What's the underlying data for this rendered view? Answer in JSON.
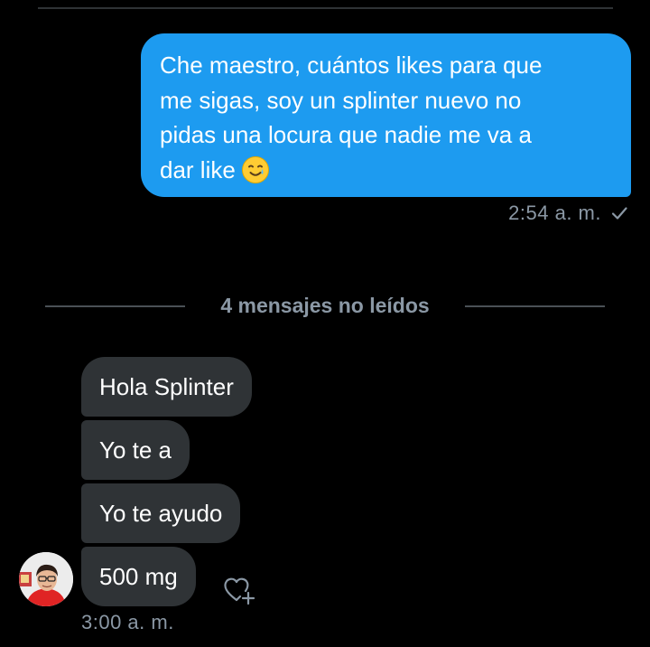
{
  "conversation": {
    "sent": {
      "lines": [
        "Che maestro, cuántos likes para que",
        "me sigas, soy un splinter nuevo no",
        "pidas una locura que nadie me va a",
        "dar like"
      ],
      "emoji_icon": "smiling-face-with-tear-icon",
      "time": "2:54 a. m.",
      "status_icon": "check-icon"
    },
    "unread_divider": "4 mensajes no leídos",
    "received": [
      {
        "text": "Hola Splinter"
      },
      {
        "text": "Yo te a"
      },
      {
        "text": "Yo te ayudo"
      },
      {
        "text": "500 mg"
      }
    ],
    "received_time": "3:00 a. m.",
    "react_icon": "add-reaction-heart-icon"
  },
  "colors": {
    "background": "#000000",
    "sent_bubble": "#1d9bf0",
    "received_bubble": "#2f3336",
    "meta_text": "#8b98a5"
  }
}
